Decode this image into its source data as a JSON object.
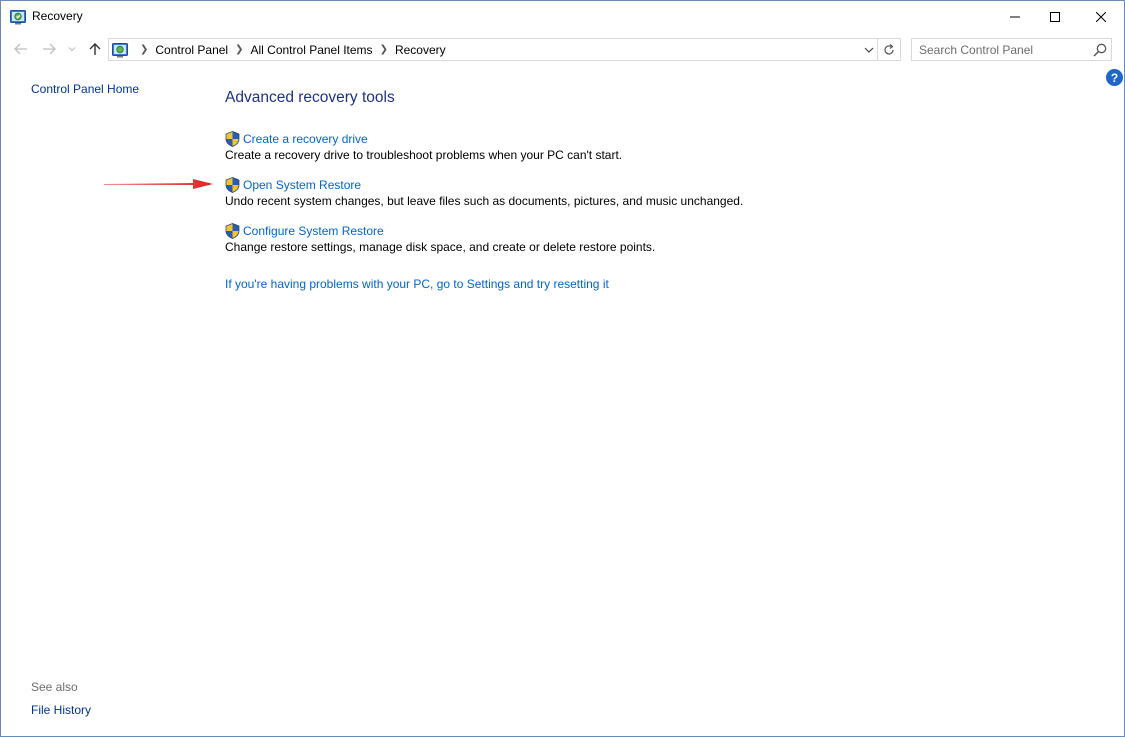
{
  "window": {
    "title": "Recovery"
  },
  "navigation": {
    "back_icon": "arrow-left-icon",
    "forward_icon": "arrow-right-icon",
    "recent_icon": "chevron-down-icon",
    "up_icon": "arrow-up-icon",
    "breadcrumbs": [
      "Control Panel",
      "All Control Panel Items",
      "Recovery"
    ],
    "refresh_icon": "refresh-icon"
  },
  "search": {
    "placeholder": "Search Control Panel"
  },
  "help": {
    "label": "?"
  },
  "left_pane": {
    "home_link": "Control Panel Home",
    "see_also_heading": "See also",
    "see_also_links": [
      "File History"
    ]
  },
  "main": {
    "title": "Advanced recovery tools",
    "tools": [
      {
        "label": "Create a recovery drive",
        "description": "Create a recovery drive to troubleshoot problems when your PC can't start."
      },
      {
        "label": "Open System Restore",
        "description": "Undo recent system changes, but leave files such as documents, pictures, and music unchanged."
      },
      {
        "label": "Configure System Restore",
        "description": "Change restore settings, manage disk space, and create or delete restore points."
      }
    ],
    "reset_link": "If you're having problems with your PC, go to Settings and try resetting it"
  },
  "colors": {
    "link": "#0066cc",
    "heading": "#1e3287",
    "annotation_arrow": "#e02020",
    "window_border": "#6a8bb5"
  }
}
